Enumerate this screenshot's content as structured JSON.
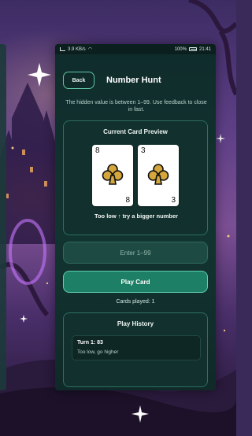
{
  "status_bar": {
    "network": "3.9 KB/s",
    "battery": "100%",
    "time": "21:41"
  },
  "header": {
    "back_label": "Back",
    "title": "Number Hunt"
  },
  "hint": "The hidden value is between 1–99. Use feedback to close in fast.",
  "preview": {
    "title": "Current Card Preview",
    "cards": [
      {
        "rank": "8",
        "suit": "clubs-icon"
      },
      {
        "rank": "3",
        "suit": "clubs-icon"
      }
    ],
    "feedback": "Too low ↑ try a bigger number"
  },
  "input": {
    "placeholder": "Enter 1–99"
  },
  "play_button": "Play Card",
  "cards_played": "Cards played: 1",
  "history": {
    "title": "Play History",
    "items": [
      {
        "turn": "Turn 1: 83",
        "message": "Too low, go higher"
      }
    ]
  },
  "colors": {
    "accent": "#1d7f66",
    "panel_bg": "#12302d",
    "border": "#2e6f62"
  }
}
